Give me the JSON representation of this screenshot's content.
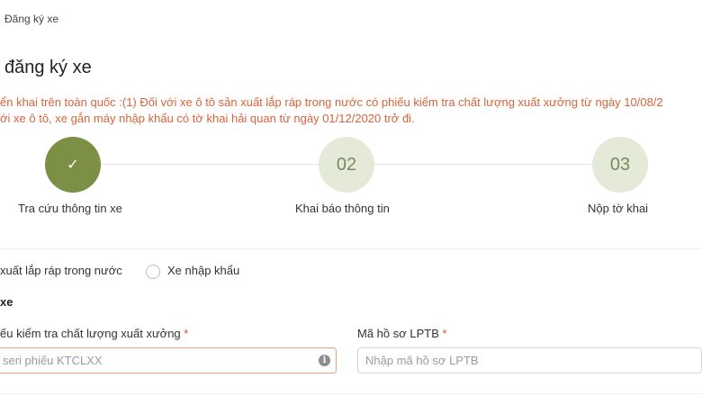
{
  "breadcrumb": {
    "current": "Đăng ký xe"
  },
  "page": {
    "title": "đăng ký xe"
  },
  "notice": {
    "line1": "ển khai trên toàn quốc :(1) Đối với xe ô tô sản xuất lắp ráp trong nước có phiếu kiểm tra chất lượng xuất xưởng từ ngày 10/08/2",
    "line2": "ới xe ô tô, xe gắn máy nhập khẩu có tờ khai hải quan từ ngày 01/12/2020 trở đi."
  },
  "steps": [
    {
      "number": "✓",
      "label": "Tra cứu thông tin xe",
      "state": "active"
    },
    {
      "number": "02",
      "label": "Khai báo thông tin",
      "state": "inactive"
    },
    {
      "number": "03",
      "label": "Nộp tờ khai",
      "state": "inactive"
    }
  ],
  "vehicle_origin": {
    "options": [
      "xuất lắp ráp trong nước",
      "Xe nhập khẩu"
    ]
  },
  "section": {
    "title": "xe"
  },
  "form": {
    "ktclxx_label": "ếu kiểm tra chất lượng xuất xưởng",
    "ktclxx_placeholder": "seri phiếu KTCLXX",
    "lptb_label": "Mã hồ sơ LPTB",
    "lptb_placeholder": "Nhập mã hồ sơ LPTB",
    "required_mark": "*",
    "info_glyph": "i"
  },
  "colors": {
    "primary": "#7b8f45",
    "step_inactive": "#e5e9d8",
    "notice": "#d9633a",
    "error_border": "#f0a47c",
    "required": "#e0463a"
  }
}
